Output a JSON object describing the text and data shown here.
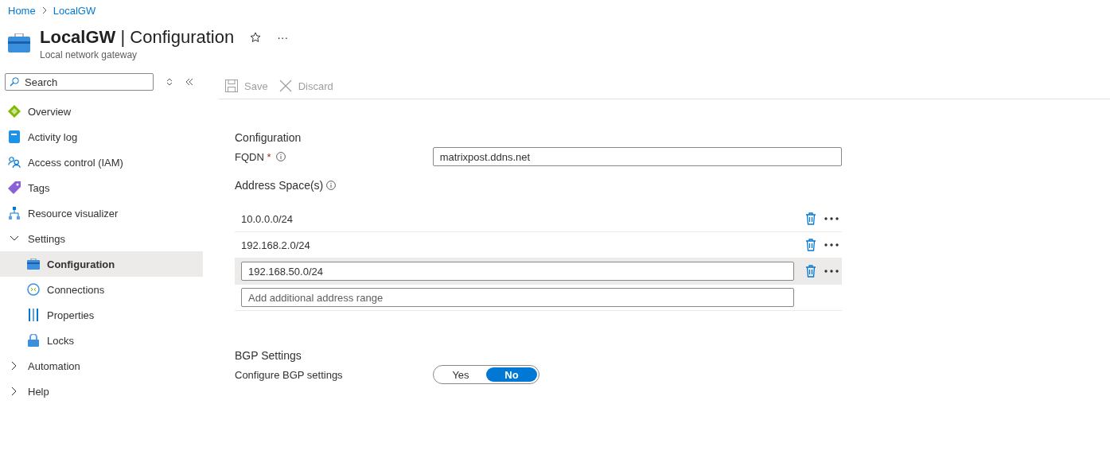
{
  "breadcrumb": [
    "Home",
    "LocalGW"
  ],
  "header": {
    "resource": "LocalGW",
    "separator": "|",
    "page": "Configuration",
    "subtitle": "Local network gateway",
    "more": "···"
  },
  "sidebar": {
    "search": {
      "placeholder": "Search"
    },
    "items": [
      {
        "label": "Overview",
        "selected": false
      },
      {
        "label": "Activity log",
        "selected": false
      },
      {
        "label": "Access control (IAM)",
        "selected": false
      },
      {
        "label": "Tags",
        "selected": false
      },
      {
        "label": "Resource visualizer",
        "selected": false
      },
      {
        "label": "Settings",
        "selected": false,
        "expanded": true,
        "children": [
          {
            "label": "Configuration",
            "selected": true
          },
          {
            "label": "Connections",
            "selected": false
          },
          {
            "label": "Properties",
            "selected": false
          },
          {
            "label": "Locks",
            "selected": false
          }
        ]
      },
      {
        "label": "Automation",
        "selected": false,
        "expanded": false
      },
      {
        "label": "Help",
        "selected": false,
        "expanded": false
      }
    ]
  },
  "toolbar": [
    {
      "label": "Save",
      "disabled": true
    },
    {
      "label": "Discard",
      "disabled": true
    }
  ],
  "form": {
    "section": "Configuration",
    "fqdn": {
      "label": "FQDN",
      "required_mark": "*",
      "value": "matrixpost.ddns.net"
    },
    "address_label": "Address Space(s)",
    "address_spaces": [
      {
        "kind": "text",
        "value": "10.0.0.0/24",
        "selected": false
      },
      {
        "kind": "text",
        "value": "192.168.2.0/24",
        "selected": false
      },
      {
        "kind": "input",
        "value": "192.168.50.0/24",
        "selected": true
      }
    ],
    "new_address": {
      "placeholder": "Add additional address range"
    },
    "bgp_section": "BGP Settings",
    "bgp": {
      "label": "Configure BGP settings",
      "options": [
        {
          "label": "Yes",
          "selected": false
        },
        {
          "label": "No",
          "selected": true
        }
      ]
    }
  }
}
